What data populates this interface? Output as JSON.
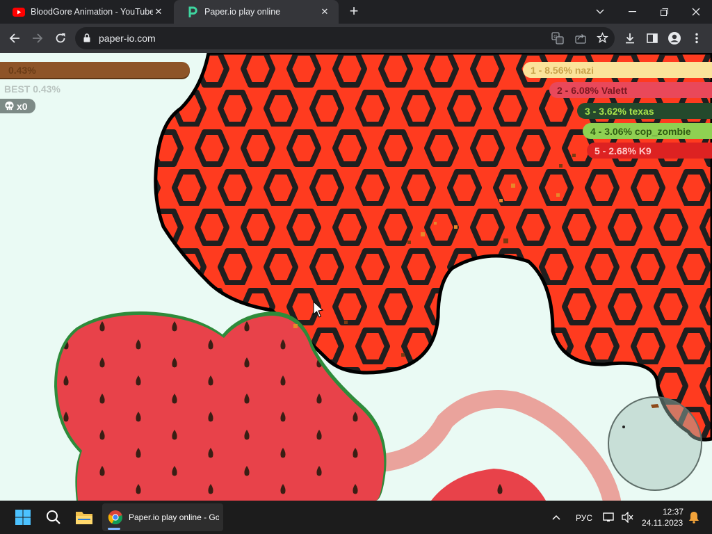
{
  "browser": {
    "tabs": [
      {
        "title": "BloodGore Animation - YouTube",
        "icon": "youtube-icon",
        "active": false
      },
      {
        "title": "Paper.io play online",
        "icon": "paperio-icon",
        "active": true
      }
    ],
    "url": "paper-io.com"
  },
  "game": {
    "hud": {
      "percent": "0.43%",
      "best": "BEST 0.43%",
      "kills": "x0"
    },
    "leaderboard": [
      {
        "label": "1 - 8.56% nazi",
        "bg": "#fbe39a",
        "color": "#c9a24b"
      },
      {
        "label": "2 - 6.08% Valett",
        "bg": "#e9485a",
        "color": "#7a1822"
      },
      {
        "label": "3 - 3.62% texas",
        "bg": "#24492c",
        "color": "#a7e24c"
      },
      {
        "label": "4 - 3.06% cop_zombie",
        "bg": "#8fd152",
        "color": "#2e5a12"
      },
      {
        "label": "5 - 2.68% K9",
        "bg": "#dd2222",
        "color": "#ffc8c8"
      }
    ]
  },
  "taskbar": {
    "chrome_task": "Paper.io play online - Go",
    "lang": "РУС",
    "time": "12:37",
    "date": "24.11.2023"
  },
  "colors": {
    "territory_red": "#ff3b1f",
    "hex_stroke": "#1f1f1f",
    "watermelon": "#e8424a",
    "watermelon_seed": "#3a1e14",
    "trail": "#eaa39c",
    "background": "#eafaf4"
  }
}
